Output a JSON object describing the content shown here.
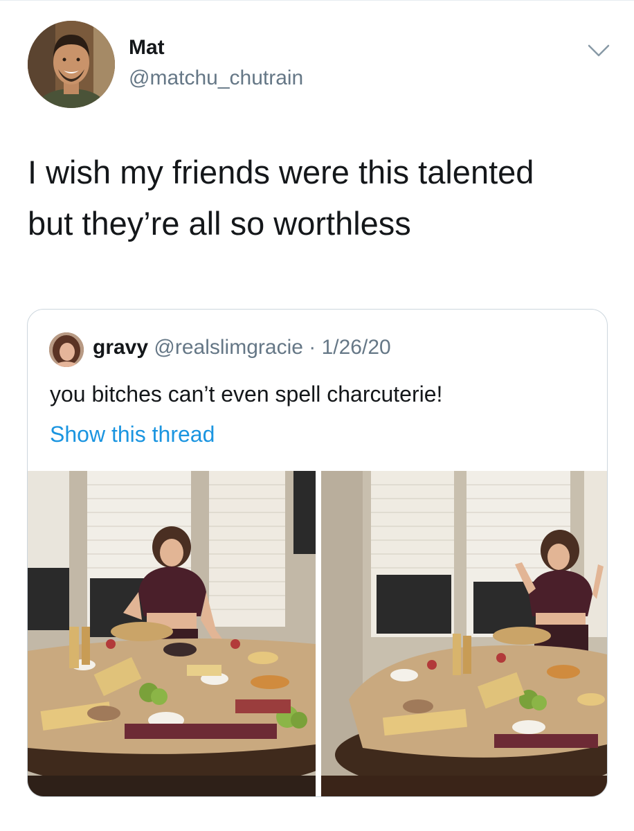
{
  "tweet": {
    "author": {
      "display_name": "Mat",
      "handle": "@matchu_chutrain"
    },
    "menu_icon": "chevron-down-icon",
    "text": "I wish my friends were this talented\nbut they’re all so worthless"
  },
  "quoted_tweet": {
    "author": {
      "display_name": "gravy",
      "handle": "@realslimgracie",
      "separator": " · ",
      "date": "1/26/20"
    },
    "text": "you bitches can’t even spell charcuterie!",
    "thread_link": "Show this thread",
    "photos": [
      "charcuterie-table-photo-1",
      "charcuterie-table-photo-2"
    ]
  },
  "colors": {
    "text_primary": "#14171a",
    "text_secondary": "#657786",
    "link": "#1b95e0",
    "border": "#ccd6dd"
  }
}
